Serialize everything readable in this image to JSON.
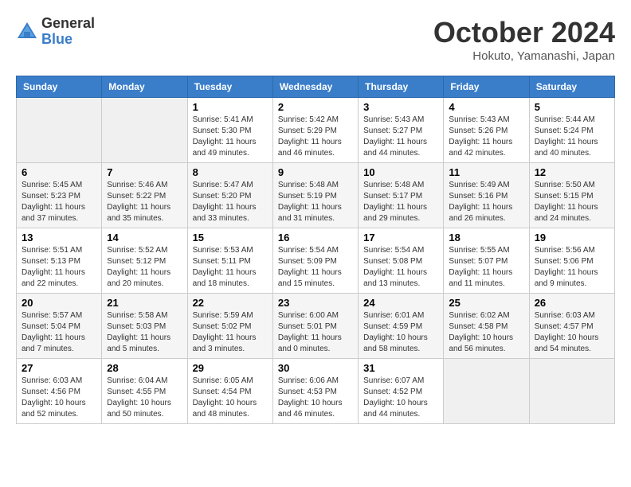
{
  "header": {
    "logo_general": "General",
    "logo_blue": "Blue",
    "month_title": "October 2024",
    "location": "Hokuto, Yamanashi, Japan"
  },
  "weekdays": [
    "Sunday",
    "Monday",
    "Tuesday",
    "Wednesday",
    "Thursday",
    "Friday",
    "Saturday"
  ],
  "weeks": [
    [
      {
        "day": "",
        "empty": true
      },
      {
        "day": "",
        "empty": true
      },
      {
        "day": "1",
        "sunrise": "Sunrise: 5:41 AM",
        "sunset": "Sunset: 5:30 PM",
        "daylight": "Daylight: 11 hours and 49 minutes."
      },
      {
        "day": "2",
        "sunrise": "Sunrise: 5:42 AM",
        "sunset": "Sunset: 5:29 PM",
        "daylight": "Daylight: 11 hours and 46 minutes."
      },
      {
        "day": "3",
        "sunrise": "Sunrise: 5:43 AM",
        "sunset": "Sunset: 5:27 PM",
        "daylight": "Daylight: 11 hours and 44 minutes."
      },
      {
        "day": "4",
        "sunrise": "Sunrise: 5:43 AM",
        "sunset": "Sunset: 5:26 PM",
        "daylight": "Daylight: 11 hours and 42 minutes."
      },
      {
        "day": "5",
        "sunrise": "Sunrise: 5:44 AM",
        "sunset": "Sunset: 5:24 PM",
        "daylight": "Daylight: 11 hours and 40 minutes."
      }
    ],
    [
      {
        "day": "6",
        "sunrise": "Sunrise: 5:45 AM",
        "sunset": "Sunset: 5:23 PM",
        "daylight": "Daylight: 11 hours and 37 minutes."
      },
      {
        "day": "7",
        "sunrise": "Sunrise: 5:46 AM",
        "sunset": "Sunset: 5:22 PM",
        "daylight": "Daylight: 11 hours and 35 minutes."
      },
      {
        "day": "8",
        "sunrise": "Sunrise: 5:47 AM",
        "sunset": "Sunset: 5:20 PM",
        "daylight": "Daylight: 11 hours and 33 minutes."
      },
      {
        "day": "9",
        "sunrise": "Sunrise: 5:48 AM",
        "sunset": "Sunset: 5:19 PM",
        "daylight": "Daylight: 11 hours and 31 minutes."
      },
      {
        "day": "10",
        "sunrise": "Sunrise: 5:48 AM",
        "sunset": "Sunset: 5:17 PM",
        "daylight": "Daylight: 11 hours and 29 minutes."
      },
      {
        "day": "11",
        "sunrise": "Sunrise: 5:49 AM",
        "sunset": "Sunset: 5:16 PM",
        "daylight": "Daylight: 11 hours and 26 minutes."
      },
      {
        "day": "12",
        "sunrise": "Sunrise: 5:50 AM",
        "sunset": "Sunset: 5:15 PM",
        "daylight": "Daylight: 11 hours and 24 minutes."
      }
    ],
    [
      {
        "day": "13",
        "sunrise": "Sunrise: 5:51 AM",
        "sunset": "Sunset: 5:13 PM",
        "daylight": "Daylight: 11 hours and 22 minutes."
      },
      {
        "day": "14",
        "sunrise": "Sunrise: 5:52 AM",
        "sunset": "Sunset: 5:12 PM",
        "daylight": "Daylight: 11 hours and 20 minutes."
      },
      {
        "day": "15",
        "sunrise": "Sunrise: 5:53 AM",
        "sunset": "Sunset: 5:11 PM",
        "daylight": "Daylight: 11 hours and 18 minutes."
      },
      {
        "day": "16",
        "sunrise": "Sunrise: 5:54 AM",
        "sunset": "Sunset: 5:09 PM",
        "daylight": "Daylight: 11 hours and 15 minutes."
      },
      {
        "day": "17",
        "sunrise": "Sunrise: 5:54 AM",
        "sunset": "Sunset: 5:08 PM",
        "daylight": "Daylight: 11 hours and 13 minutes."
      },
      {
        "day": "18",
        "sunrise": "Sunrise: 5:55 AM",
        "sunset": "Sunset: 5:07 PM",
        "daylight": "Daylight: 11 hours and 11 minutes."
      },
      {
        "day": "19",
        "sunrise": "Sunrise: 5:56 AM",
        "sunset": "Sunset: 5:06 PM",
        "daylight": "Daylight: 11 hours and 9 minutes."
      }
    ],
    [
      {
        "day": "20",
        "sunrise": "Sunrise: 5:57 AM",
        "sunset": "Sunset: 5:04 PM",
        "daylight": "Daylight: 11 hours and 7 minutes."
      },
      {
        "day": "21",
        "sunrise": "Sunrise: 5:58 AM",
        "sunset": "Sunset: 5:03 PM",
        "daylight": "Daylight: 11 hours and 5 minutes."
      },
      {
        "day": "22",
        "sunrise": "Sunrise: 5:59 AM",
        "sunset": "Sunset: 5:02 PM",
        "daylight": "Daylight: 11 hours and 3 minutes."
      },
      {
        "day": "23",
        "sunrise": "Sunrise: 6:00 AM",
        "sunset": "Sunset: 5:01 PM",
        "daylight": "Daylight: 11 hours and 0 minutes."
      },
      {
        "day": "24",
        "sunrise": "Sunrise: 6:01 AM",
        "sunset": "Sunset: 4:59 PM",
        "daylight": "Daylight: 10 hours and 58 minutes."
      },
      {
        "day": "25",
        "sunrise": "Sunrise: 6:02 AM",
        "sunset": "Sunset: 4:58 PM",
        "daylight": "Daylight: 10 hours and 56 minutes."
      },
      {
        "day": "26",
        "sunrise": "Sunrise: 6:03 AM",
        "sunset": "Sunset: 4:57 PM",
        "daylight": "Daylight: 10 hours and 54 minutes."
      }
    ],
    [
      {
        "day": "27",
        "sunrise": "Sunrise: 6:03 AM",
        "sunset": "Sunset: 4:56 PM",
        "daylight": "Daylight: 10 hours and 52 minutes."
      },
      {
        "day": "28",
        "sunrise": "Sunrise: 6:04 AM",
        "sunset": "Sunset: 4:55 PM",
        "daylight": "Daylight: 10 hours and 50 minutes."
      },
      {
        "day": "29",
        "sunrise": "Sunrise: 6:05 AM",
        "sunset": "Sunset: 4:54 PM",
        "daylight": "Daylight: 10 hours and 48 minutes."
      },
      {
        "day": "30",
        "sunrise": "Sunrise: 6:06 AM",
        "sunset": "Sunset: 4:53 PM",
        "daylight": "Daylight: 10 hours and 46 minutes."
      },
      {
        "day": "31",
        "sunrise": "Sunrise: 6:07 AM",
        "sunset": "Sunset: 4:52 PM",
        "daylight": "Daylight: 10 hours and 44 minutes."
      },
      {
        "day": "",
        "empty": true
      },
      {
        "day": "",
        "empty": true
      }
    ]
  ]
}
